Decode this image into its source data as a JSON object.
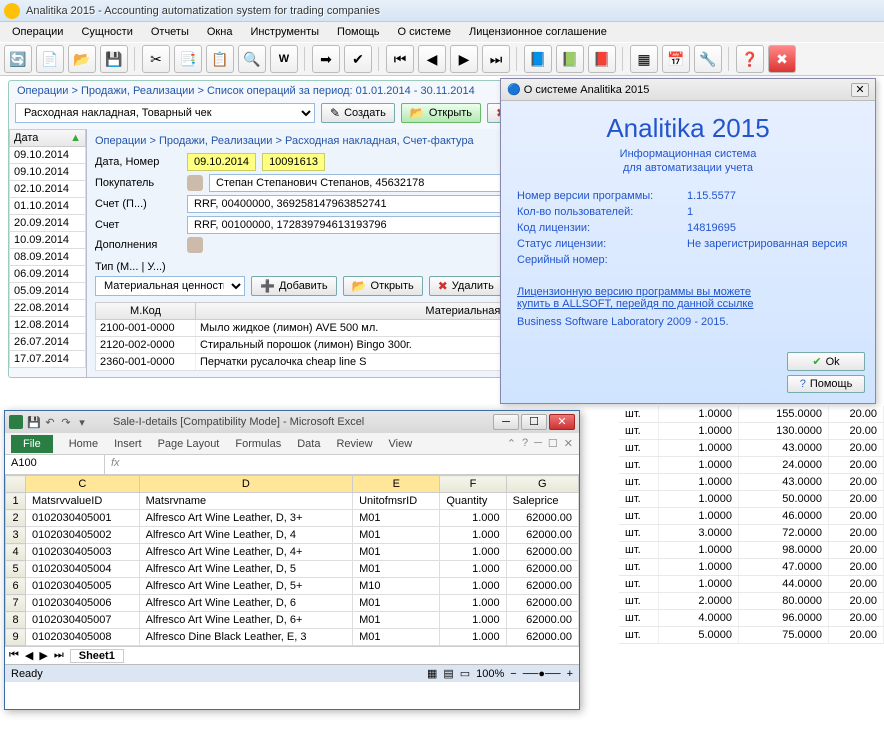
{
  "app": {
    "title": "Analitika 2015 - Accounting automatization system for trading companies"
  },
  "menu": [
    "Операции",
    "Сущности",
    "Отчеты",
    "Окна",
    "Инструменты",
    "Помощь",
    "О системе",
    "Лицензионное соглашение"
  ],
  "opwin": {
    "breadcrumb": "Операции > Продажи, Реализации > Список операций за период: 01.01.2014 - 30.11.2014",
    "filter_select": "Расходная накладная, Товарный чек",
    "btn_create": "Создать",
    "btn_open": "Открыть",
    "date_hdr": "Дата",
    "dates": [
      "09.10.2014",
      "09.10.2014",
      "02.10.2014",
      "01.10.2014",
      "20.09.2014",
      "10.09.2014",
      "08.09.2014",
      "06.09.2014",
      "05.09.2014",
      "22.08.2014",
      "12.08.2014",
      "26.07.2014",
      "17.07.2014"
    ]
  },
  "detail": {
    "breadcrumb": "Операции > Продажи, Реализации > Расходная накладная, Счет-фактура",
    "lbl_date_num": "Дата, Номер",
    "date": "09.10.2014",
    "num": "10091613",
    "lbl_buyer": "Покупатель",
    "buyer": "Степан Степанович Степанов, 45632178",
    "lbl_acct_p": "Счет (П...)",
    "acct_p": "RRF, 00400000, 369258147963852741",
    "lbl_acct": "Счет",
    "acct": "RRF, 00100000, 172839794613193796",
    "lbl_add": "Дополнения",
    "lbl_type": "Тип (М... | У...)",
    "type_select": "Материальная ценность",
    "btn_add": "Добавить",
    "btn_open": "Открыть",
    "btn_delete": "Удалить",
    "col_code": "М.Код",
    "col_name": "Материальная ценность.Наименование..",
    "rows": [
      {
        "code": "2100-001-0000",
        "name": "Мыло жидкое (лимон) AVE 500 мл."
      },
      {
        "code": "2120-002-0000",
        "name": "Стиральный порошок (лимон) Bingo 300г."
      },
      {
        "code": "2360-001-0000",
        "name": "Перчатки русалочка cheap line S"
      }
    ]
  },
  "about": {
    "title": "О системе Analitika 2015",
    "h1": "Analitika 2015",
    "sub1": "Информационная система",
    "sub2": "для автоматизации учета",
    "k_ver": "Номер версии программы:",
    "v_ver": "1.15.5577",
    "k_users": "Кол-во пользователей:",
    "v_users": "1",
    "k_lic": "Код лицензии:",
    "v_lic": "14819695",
    "k_stat": "Статус лицензии:",
    "v_stat": "Не зарегистрированная версия",
    "k_ser": "Серийный номер:",
    "v_ser": "",
    "link1": "Лицензионную версию программы вы можете",
    "link2": "купить в ALLSOFT, перейдя по данной ссылке",
    "foot": "Business Software Laboratory 2009 - 2015.",
    "btn_ok": "Ok",
    "btn_help": "Помощь"
  },
  "bggrid": {
    "unit": "шт.",
    "rows": [
      [
        1.0,
        155.0,
        20.0
      ],
      [
        1.0,
        130.0,
        20.0
      ],
      [
        1.0,
        43.0,
        20.0
      ],
      [
        1.0,
        24.0,
        20.0
      ],
      [
        1.0,
        43.0,
        20.0
      ],
      [
        1.0,
        50.0,
        20.0
      ],
      [
        1.0,
        46.0,
        20.0
      ],
      [
        3.0,
        72.0,
        20.0
      ],
      [
        1.0,
        98.0,
        20.0
      ],
      [
        1.0,
        47.0,
        20.0
      ],
      [
        1.0,
        44.0,
        20.0
      ],
      [
        2.0,
        80.0,
        20.0
      ],
      [
        4.0,
        96.0,
        20.0
      ],
      [
        5.0,
        75.0,
        20.0
      ]
    ]
  },
  "excel": {
    "title": "Sale-I-details  [Compatibility Mode]  -  Microsoft Excel",
    "tabs": [
      "File",
      "Home",
      "Insert",
      "Page Layout",
      "Formulas",
      "Data",
      "Review",
      "View"
    ],
    "cellref": "A100",
    "fx_label": "fx",
    "cols": [
      "",
      "",
      "C",
      "D",
      "E",
      "F",
      "G"
    ],
    "headers": [
      "MatsrvvalueID",
      "Matsrvname",
      "UnitofmsrID",
      "Quantity",
      "Saleprice"
    ],
    "rows": [
      [
        "0102030405001",
        "Alfresco Art Wine Leather, D, 3+",
        "M01",
        "1.000",
        "62000.00"
      ],
      [
        "0102030405002",
        "Alfresco Art Wine Leather, D, 4",
        "M01",
        "1.000",
        "62000.00"
      ],
      [
        "0102030405003",
        "Alfresco Art Wine Leather, D, 4+",
        "M01",
        "1.000",
        "62000.00"
      ],
      [
        "0102030405004",
        "Alfresco Art Wine Leather, D, 5",
        "M01",
        "1.000",
        "62000.00"
      ],
      [
        "0102030405005",
        "Alfresco Art Wine Leather, D, 5+",
        "M10",
        "1.000",
        "62000.00"
      ],
      [
        "0102030405006",
        "Alfresco Art Wine Leather, D, 6",
        "M01",
        "1.000",
        "62000.00"
      ],
      [
        "0102030405007",
        "Alfresco Art Wine Leather, D, 6+",
        "M01",
        "1.000",
        "62000.00"
      ],
      [
        "0102030405008",
        "Alfresco Dine Black Leather, E, 3",
        "M01",
        "1.000",
        "62000.00"
      ]
    ],
    "sheet_name": "Sheet1",
    "status": "Ready",
    "zoom": "100%"
  }
}
